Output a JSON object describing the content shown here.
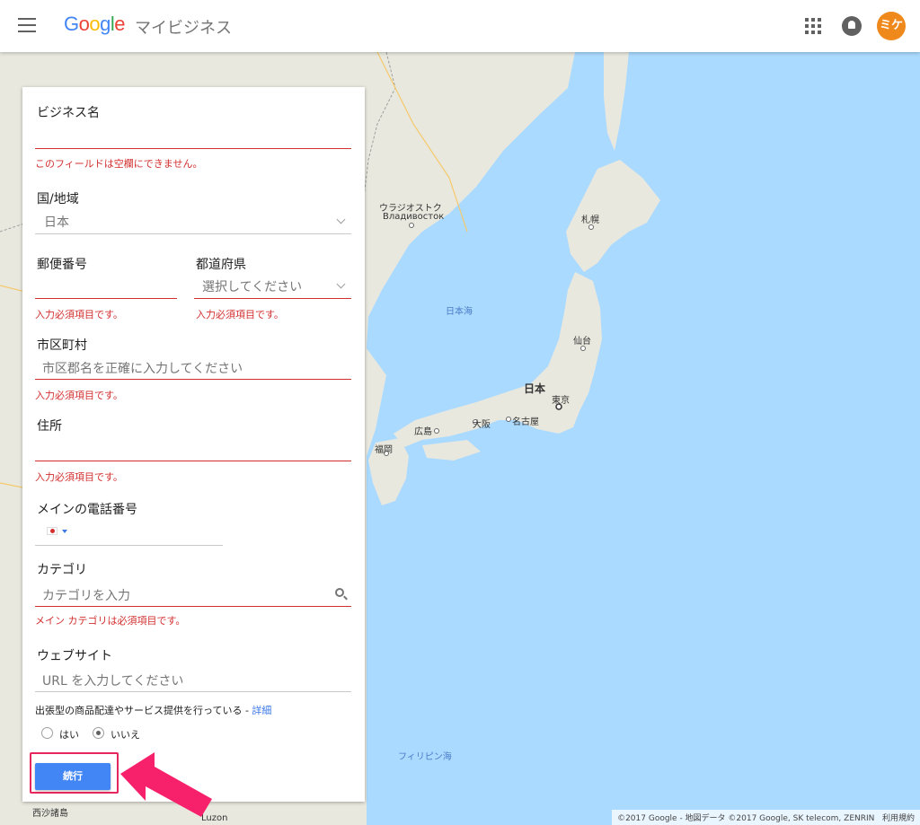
{
  "header": {
    "menu_icon": "hamburger-menu-icon",
    "logo": [
      "G",
      "o",
      "o",
      "g",
      "l",
      "e"
    ],
    "logo_colors": [
      "#4285f4",
      "#ea4335",
      "#fbbc05",
      "#4285f4",
      "#34a853",
      "#ea4335"
    ],
    "product": "マイビジネス",
    "apps_icon": "apps-grid-icon",
    "notifications_icon": "bell-icon",
    "avatar_text": "ミケ",
    "avatar_color": "#f0891c"
  },
  "form": {
    "business_name": {
      "label": "ビジネス名",
      "value": "",
      "error": "このフィールドは空欄にできません。"
    },
    "country": {
      "label": "国/地域",
      "value": "日本"
    },
    "postal_code": {
      "label": "郵便番号",
      "value": "",
      "error": "入力必須項目です。"
    },
    "prefecture": {
      "label": "都道府県",
      "placeholder": "選択してください",
      "error": "入力必須項目です。"
    },
    "city": {
      "label": "市区町村",
      "placeholder": "市区郡名を正確に入力してください",
      "error": "入力必須項目です。"
    },
    "address": {
      "label": "住所",
      "value": "",
      "error": "入力必須項目です。"
    },
    "phone": {
      "label": "メインの電話番号",
      "flag_icon": "japan-flag-icon",
      "value": ""
    },
    "category": {
      "label": "カテゴリ",
      "placeholder": "カテゴリを入力",
      "error": "メイン カテゴリは必須項目です。"
    },
    "website": {
      "label": "ウェブサイト",
      "placeholder": "URL を入力してください"
    },
    "delivery": {
      "question": "出張型の商品配達やサービス提供を行っている - ",
      "details_link": "詳細",
      "options": [
        "はい",
        "いいえ"
      ],
      "selected": "いいえ"
    },
    "continue_button": "続行",
    "highlight_color": "#e8265e"
  },
  "map": {
    "labels": {
      "vladivostok_ja": "ウラジオストク",
      "vladivostok_ru": "Владивосток",
      "sapporo": "札幌",
      "sea_of_japan": "日本海",
      "sendai": "仙台",
      "japan": "日本",
      "tokyo": "東京",
      "nagoya": "名古屋",
      "osaka": "大阪",
      "hiroshima": "広島",
      "fukuoka": "福岡",
      "philippine_sea": "フィリピン海",
      "paracel": "西沙諸島",
      "luzon": "Luzon"
    },
    "attribution": "©2017 Google - 地図データ ©2017 Google, SK telecom, ZENRIN",
    "terms": "利用規約",
    "sea_color": "#aadaff",
    "land_color": "#e8e8df"
  }
}
